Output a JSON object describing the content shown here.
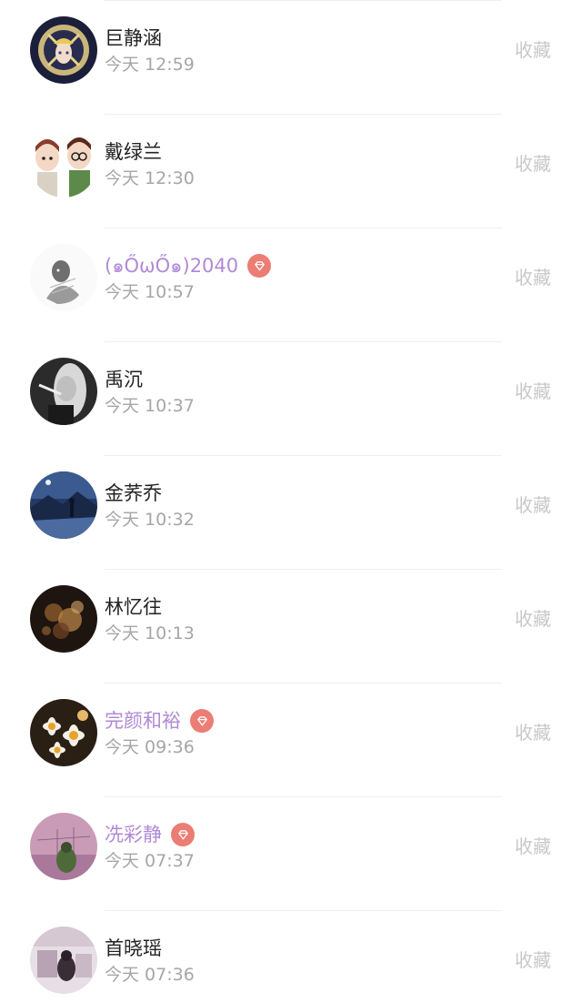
{
  "favorite_label": "收藏",
  "colors": {
    "vip_name": "#b08ad6",
    "vip_badge": "#ec7d74",
    "time_text": "#a6a6a6",
    "favorite_text": "#c8c8c8"
  },
  "rows": [
    {
      "name": "巨静涵",
      "time": "今天 12:59",
      "vip": false,
      "avatar": "anime-girl-avatar"
    },
    {
      "name": "戴绿兰",
      "time": "今天 12:30",
      "vip": false,
      "avatar": "cartoon-couple-avatar"
    },
    {
      "name": "(๑ŐωŐ๑)2040",
      "time": "今天 10:57",
      "vip": true,
      "avatar": "sketch-avatar"
    },
    {
      "name": "禹沉",
      "time": "今天 10:37",
      "vip": false,
      "avatar": "bw-portrait-avatar"
    },
    {
      "name": "金荞乔",
      "time": "今天 10:32",
      "vip": false,
      "avatar": "night-landscape-avatar"
    },
    {
      "name": "林忆往",
      "time": "今天 10:13",
      "vip": false,
      "avatar": "bokeh-lights-avatar"
    },
    {
      "name": "完颜和裕",
      "time": "今天 09:36",
      "vip": true,
      "avatar": "flowers-avatar"
    },
    {
      "name": "冼彩静",
      "time": "今天 07:37",
      "vip": true,
      "avatar": "pink-illustration-avatar"
    },
    {
      "name": "首晓瑶",
      "time": "今天 07:36",
      "vip": false,
      "avatar": "pastel-photo-avatar"
    }
  ]
}
